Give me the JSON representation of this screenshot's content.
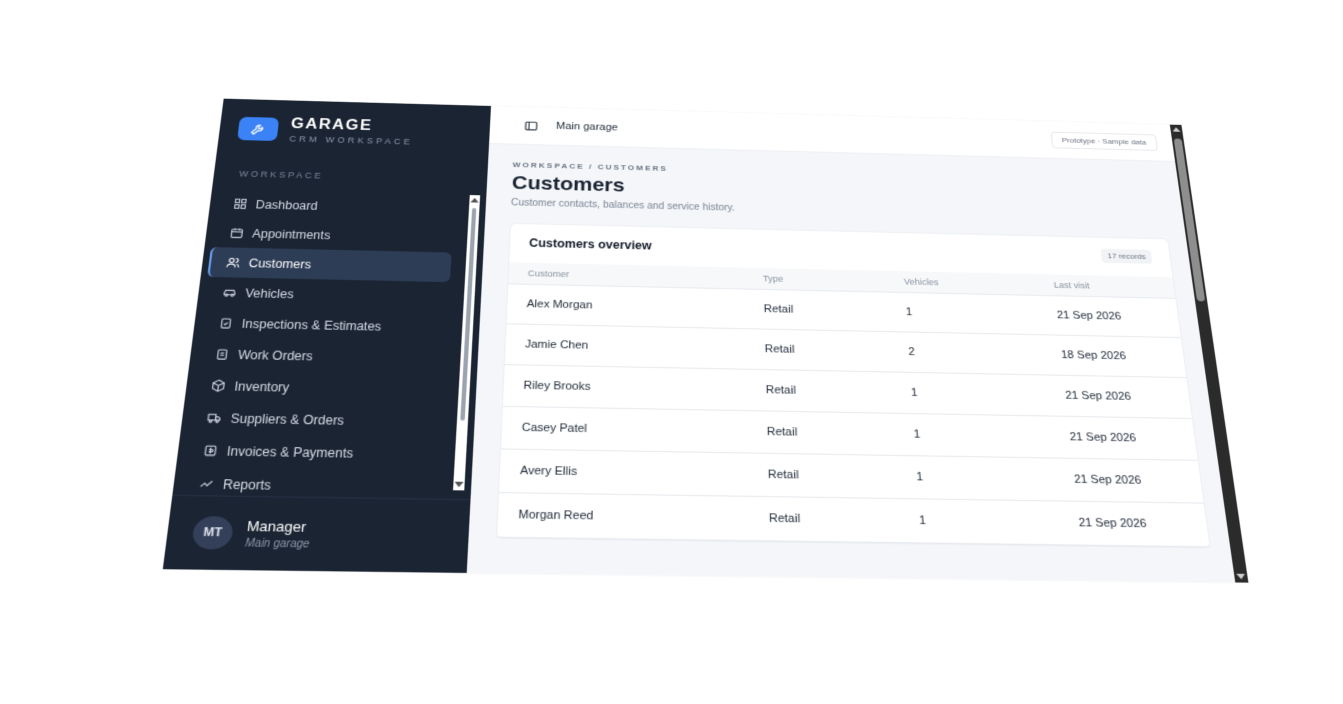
{
  "brand": {
    "title": "GARAGE",
    "subtitle": "CRM WORKSPACE",
    "logo_icon": "wrench-icon",
    "accent": "#3b82f6"
  },
  "sidebar": {
    "section_label": "WORKSPACE",
    "items": [
      {
        "label": "Dashboard",
        "icon": "dashboard-icon",
        "active": false
      },
      {
        "label": "Appointments",
        "icon": "calendar-icon",
        "active": false
      },
      {
        "label": "Customers",
        "icon": "users-icon",
        "active": true
      },
      {
        "label": "Vehicles",
        "icon": "car-icon",
        "active": false
      },
      {
        "label": "Inspections & Estimates",
        "icon": "clipboard-check-icon",
        "active": false
      },
      {
        "label": "Work Orders",
        "icon": "clipboard-list-icon",
        "active": false
      },
      {
        "label": "Inventory",
        "icon": "box-icon",
        "active": false
      },
      {
        "label": "Suppliers & Orders",
        "icon": "truck-icon",
        "active": false
      },
      {
        "label": "Invoices & Payments",
        "icon": "invoice-icon",
        "active": false
      },
      {
        "label": "Reports",
        "icon": "chart-icon",
        "active": false
      }
    ],
    "colors": {
      "background": "#1b2433",
      "active_background": "#2d3d56"
    }
  },
  "user": {
    "initials": "MT",
    "name": "Manager",
    "location": "Main garage"
  },
  "topbar": {
    "workspace": "Main garage",
    "pill": "Prototype · Sample data",
    "toggle_icon": "sidebar-toggle-icon"
  },
  "page": {
    "breadcrumb": "WORKSPACE / CUSTOMERS",
    "title": "Customers",
    "subtitle": "Customer contacts, balances and service history."
  },
  "card": {
    "title": "Customers overview",
    "badge": "17 records",
    "columns": [
      "Customer",
      "Type",
      "Vehicles",
      "Last visit"
    ],
    "rows": [
      [
        "Alex Morgan",
        "Retail",
        "1",
        "21 Sep 2026"
      ],
      [
        "Jamie Chen",
        "Retail",
        "2",
        "18 Sep 2026"
      ],
      [
        "Riley Brooks",
        "Retail",
        "1",
        "21 Sep 2026"
      ],
      [
        "Casey Patel",
        "Retail",
        "1",
        "21 Sep 2026"
      ],
      [
        "Avery Ellis",
        "Retail",
        "1",
        "21 Sep 2026"
      ],
      [
        "Morgan Reed",
        "Retail",
        "1",
        "21 Sep 2026"
      ]
    ]
  }
}
